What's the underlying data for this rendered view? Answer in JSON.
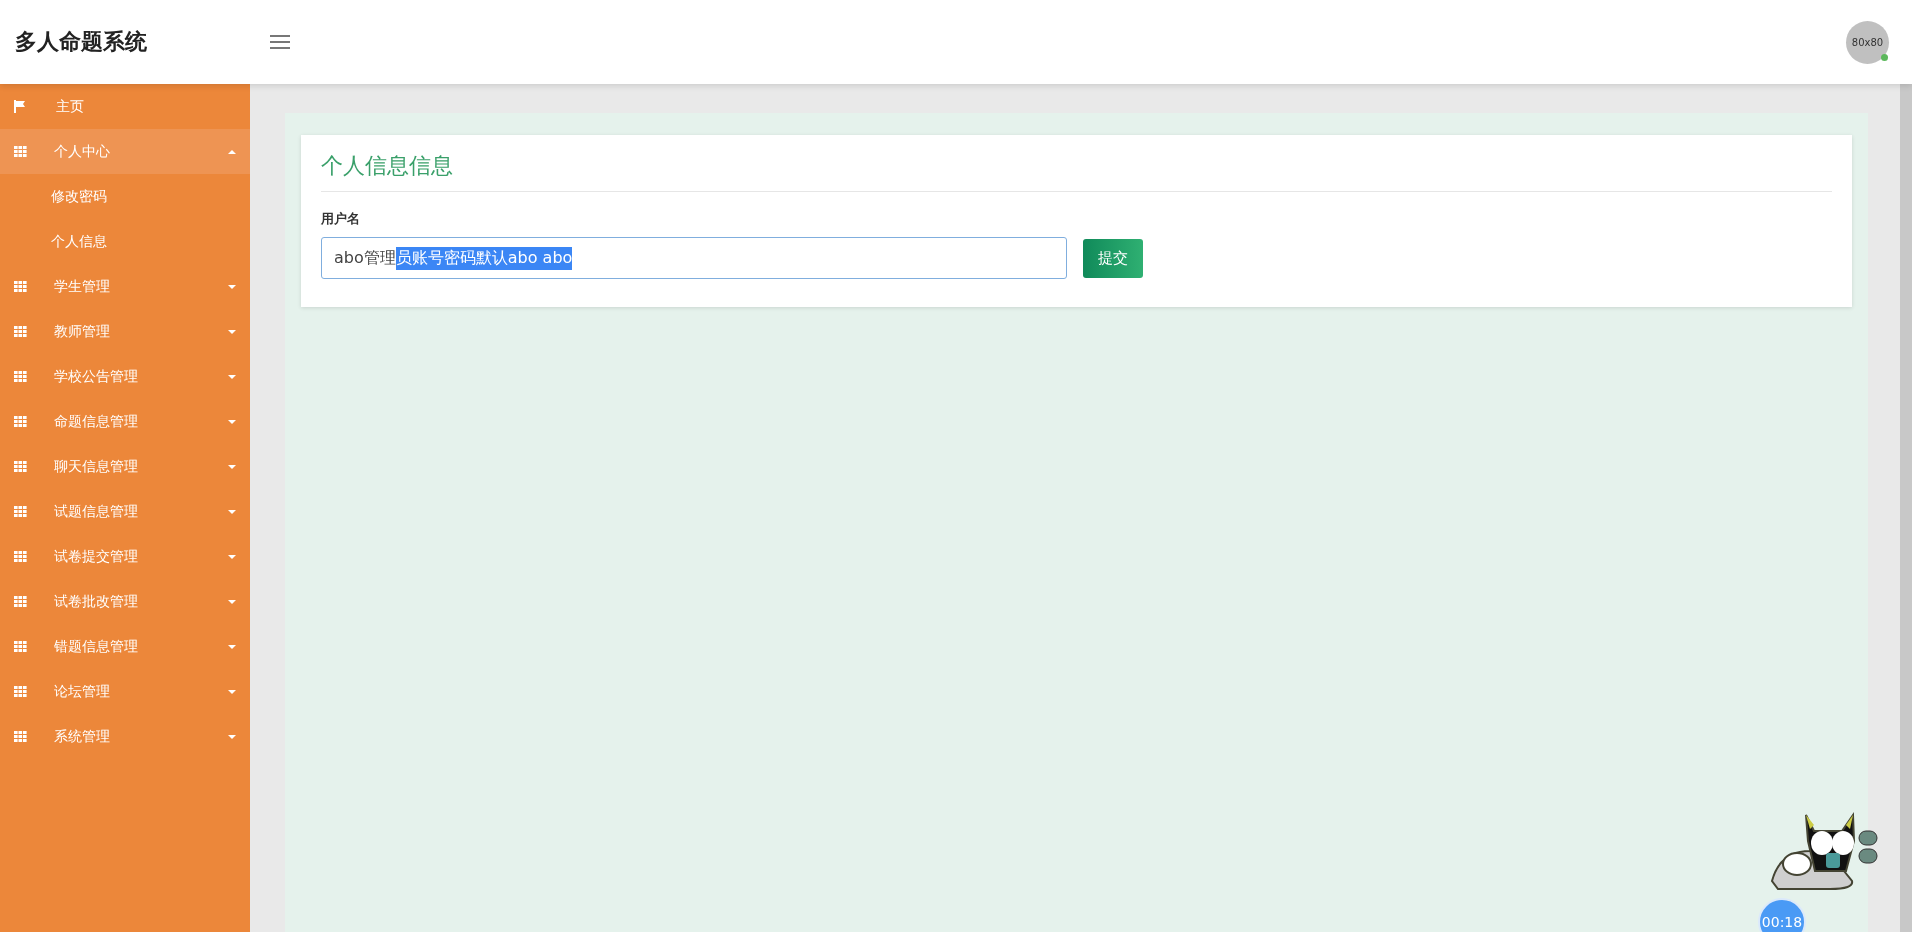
{
  "header": {
    "title": "多人命题系统",
    "avatar_text": "80x80",
    "online": true
  },
  "sidebar": {
    "items": [
      {
        "label": "主页",
        "kind": "flag",
        "selected": false
      },
      {
        "label": "个人中心",
        "kind": "grid",
        "expanded": true,
        "selected": true,
        "children": [
          {
            "label": "修改密码"
          },
          {
            "label": "个人信息"
          }
        ]
      },
      {
        "label": "学生管理",
        "kind": "grid",
        "expanded": false,
        "selected": false
      },
      {
        "label": "教师管理",
        "kind": "grid",
        "expanded": false,
        "selected": false
      },
      {
        "label": "学校公告管理",
        "kind": "grid",
        "expanded": false,
        "selected": false
      },
      {
        "label": "命题信息管理",
        "kind": "grid",
        "expanded": false,
        "selected": false
      },
      {
        "label": "聊天信息管理",
        "kind": "grid",
        "expanded": false,
        "selected": false
      },
      {
        "label": "试题信息管理",
        "kind": "grid",
        "expanded": false,
        "selected": false
      },
      {
        "label": "试卷提交管理",
        "kind": "grid",
        "expanded": false,
        "selected": false
      },
      {
        "label": "试卷批改管理",
        "kind": "grid",
        "expanded": false,
        "selected": false
      },
      {
        "label": "错题信息管理",
        "kind": "grid",
        "expanded": false,
        "selected": false
      },
      {
        "label": "论坛管理",
        "kind": "grid",
        "expanded": false,
        "selected": false
      },
      {
        "label": "系统管理",
        "kind": "grid",
        "expanded": false,
        "selected": false
      }
    ]
  },
  "form": {
    "title": "个人信息信息",
    "field_label": "用户名",
    "value_parts": [
      {
        "text": "abo管理",
        "selected": false
      },
      {
        "text": "员账号密码默认abo abo",
        "selected": true
      }
    ],
    "submit": "提交"
  },
  "timer": "00:18"
}
